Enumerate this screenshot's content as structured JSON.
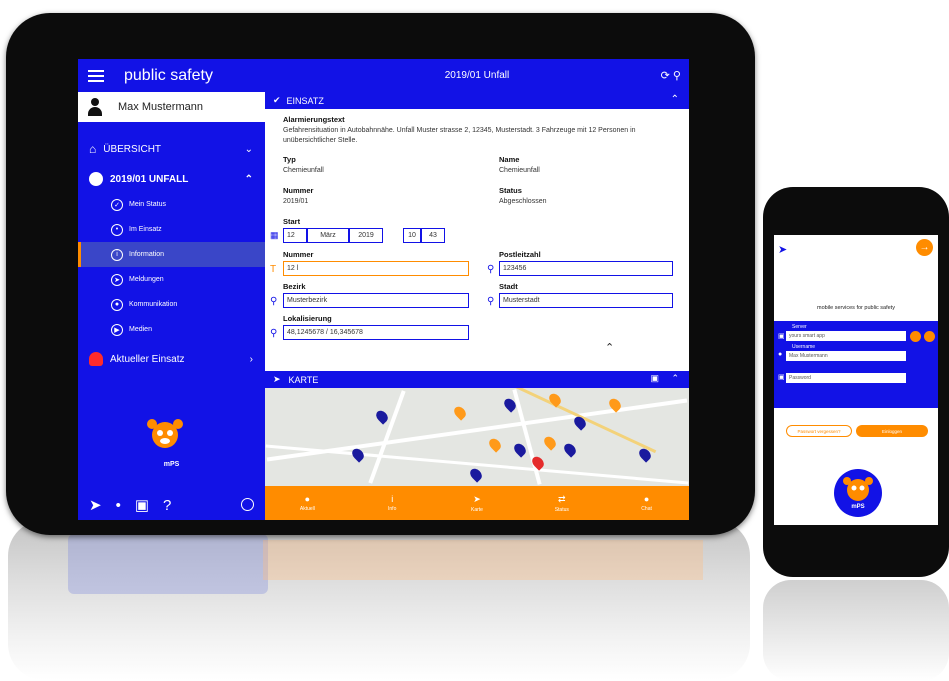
{
  "tablet": {
    "app_title": "public safety",
    "user_name": "Max Mustermann",
    "nav": {
      "overview": "ÜBERSICHT",
      "incident": "2019/01 UNFALL",
      "sub_items": [
        "Mein Status",
        "Im Einsatz",
        "Information",
        "Meldungen",
        "Kommunikation",
        "Medien"
      ],
      "current": "Aktueller Einsatz"
    },
    "logo_text": "mPS",
    "header_title": "2019/01 Unfall",
    "section_title": "EINSATZ",
    "alert_label": "Alarmierungstext",
    "alert_text": "Gefahrensituation in Autobahnnähe. Unfall Muster strasse 2, 12345, Musterstadt. 3 Fahrzeuge mit 12 Personen in unübersichtlicher Stelle.",
    "fields": {
      "typ_label": "Typ",
      "typ_value": "Chemieunfall",
      "name_label": "Name",
      "name_value": "Chemieunfall",
      "nummer_label": "Nummer",
      "nummer_value": "2019/01",
      "status_label": "Status",
      "status_value": "Abgeschlossen",
      "start_label": "Start",
      "start_day": "12",
      "start_month": "März",
      "start_year": "2019",
      "start_hour": "10",
      "start_min": "43",
      "nummer2_label": "Nummer",
      "nummer2_value": "12 l",
      "plz_label": "Postleitzahl",
      "plz_value": "123456",
      "bezirk_label": "Bezirk",
      "bezirk_value": "Musterbezirk",
      "stadt_label": "Stadt",
      "stadt_value": "Musterstadt",
      "lokal_label": "Lokalisierung",
      "lokal_value": "48,1245678 / 16,345678"
    },
    "map_title": "KARTE",
    "tabs": [
      "Aktuell",
      "Info",
      "Karte",
      "Status",
      "Chat"
    ]
  },
  "phone": {
    "subtitle": "mobile services for public safety",
    "server_label": "Server",
    "server_value": "yours smart app",
    "username_label": "Username",
    "username_value": "Max Mustermann",
    "password_placeholder": "Password",
    "forgot_label": "Passwort vergessen?",
    "login_label": "Einloggen",
    "logo_text": "mPS"
  },
  "colors": {
    "primary": "#1212e6",
    "accent": "#ff8c00",
    "alert": "#e52b2b"
  }
}
